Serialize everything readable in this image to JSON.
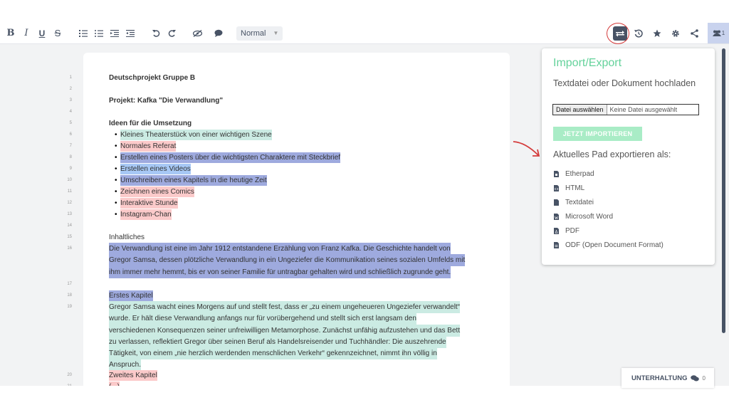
{
  "toolbar": {
    "bold": "B",
    "italic": "I",
    "underline": "U",
    "strike": "S",
    "style_select": "Normal",
    "user_count": "1"
  },
  "doc": {
    "line_numbers": [
      "1",
      "2",
      "3",
      "4",
      "5",
      "6",
      "7",
      "8",
      "9",
      "10",
      "11",
      "12",
      "13",
      "14",
      "15",
      "16",
      "17",
      "18",
      "19",
      "20",
      "21"
    ],
    "title": "Deutschprojekt Gruppe B",
    "project": "Projekt: Kafka \"Die Verwandlung\"",
    "ideas_heading": "Ideen für die Umsetzung",
    "ideas": [
      {
        "text": "Kleines Theaterstück von einer wichtigen Szene",
        "color": "teal"
      },
      {
        "text": "Normales Referat",
        "color": "pink"
      },
      {
        "text": "Erstellen eines Posters über die wichtigsten Charaktere mit Steckbrief",
        "color": "purple"
      },
      {
        "text": "Erstellen eines Videos",
        "color": "blue"
      },
      {
        "text": "Umschreiben eines Kapitels in die heutige Zeit",
        "color": "purple"
      },
      {
        "text": "Zeichnen eines Comics",
        "color": "pink"
      },
      {
        "text": "Interaktive Stunde",
        "color": "pink"
      },
      {
        "text": "Instagram-Chan",
        "color": "pink"
      }
    ],
    "content_heading": "Inhaltliches",
    "summary": [
      "Die Verwandlung ist eine im Jahr 1912 entstandene Erzählung von Franz Kafka. Die Geschichte handelt von",
      "Gregor Samsa, dessen plötzliche Verwandlung in ein Ungeziefer die Kommunikation seines sozialen Umfelds mit",
      "ihm immer mehr hemmt, bis er von seiner Familie für untragbar gehalten wird und schließlich zugrunde geht."
    ],
    "chapter1_heading": "Erstes Kapitel",
    "chapter1": [
      "Gregor Samsa wacht eines Morgens auf und stellt fest, dass er „zu einem ungeheueren Ungeziefer verwandelt“",
      "wurde. Er hält diese Verwandlung anfangs nur für vorübergehend und stellt sich erst langsam den",
      "verschiedenen Konsequenzen seiner unfreiwilligen Metamorphose. Zunächst unfähig aufzustehen und das Bett",
      "zu verlassen, reflektiert Gregor über seinen Beruf als Handelsreisender und Tuchhändler: Die auszehrende",
      "Tätigkeit, von einem „nie herzlich werdenden menschlichen Verkehr“ gekennzeichnet, nimmt ihn völlig in",
      "Anspruch."
    ],
    "chapter2_heading": "Zweites Kapitel",
    "ellipsis": "(...)"
  },
  "popup": {
    "title": "Import/Export",
    "upload_label": "Textdatei oder Dokument hochladen",
    "file_button": "Datei auswählen",
    "file_none": "Keine Datei ausgewählt",
    "import_button": "JETZT IMPORTIEREN",
    "export_label": "Aktuelles Pad exportieren als:",
    "export_items": [
      "Etherpad",
      "HTML",
      "Textdatei",
      "Microsoft Word",
      "PDF",
      "ODF (Open Document Format)"
    ]
  },
  "chat": {
    "label": "UNTERHALTUNG",
    "count": "0"
  },
  "colors": {
    "accent_green": "#64d29b",
    "annotation_red": "#d43b3b",
    "highlight_teal": "#cbebe3",
    "highlight_pink": "#fbcaca",
    "highlight_purple": "#9eaade",
    "highlight_blue": "#a7c8f5"
  }
}
